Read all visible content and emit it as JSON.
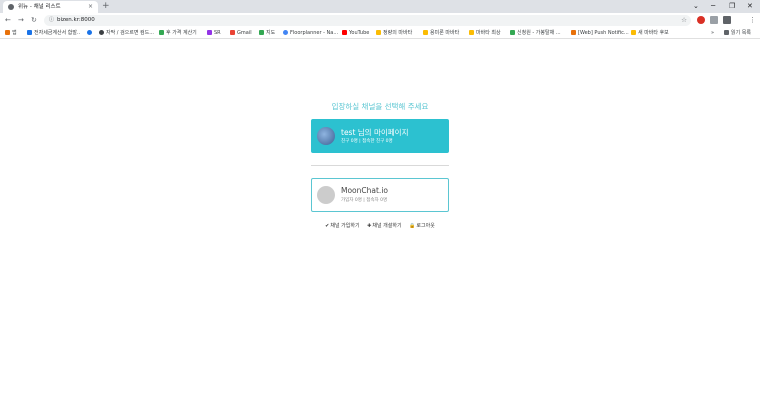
{
  "browser": {
    "tab_title": "위뉴 - 채널 리스트",
    "tab_close": "×",
    "new_tab": "+",
    "url": "bizen.kr:8000",
    "window_controls": [
      "⌄",
      "─",
      "❐",
      "✕"
    ]
  },
  "bookmarks": [
    {
      "label": "앱",
      "color": "#e8710a"
    },
    {
      "label": "전자세금계산서 합발..",
      "color": "#1a73e8"
    },
    {
      "label": "",
      "color": "#1a73e8"
    },
    {
      "label": "자막 / 검으르면 컴드...",
      "color": "#3c4043"
    },
    {
      "label": "후 가격 계산기",
      "color": "#34a853"
    },
    {
      "label": "SR",
      "color": "#9334e6"
    },
    {
      "label": "Gmail",
      "color": "#ea4335"
    },
    {
      "label": "지도",
      "color": "#34a853"
    },
    {
      "label": "Floorplanner - Na...",
      "color": "#4285f4"
    },
    {
      "label": "YouTube",
      "color": "#ff0000"
    },
    {
      "label": "정량의 마바타",
      "color": "#fbbc04"
    },
    {
      "label": "용미론 마바타",
      "color": "#fbbc04"
    },
    {
      "label": "마바타 최상",
      "color": "#fbbc04"
    },
    {
      "label": "신청원 - 가봉탈채 ...",
      "color": "#34a853"
    },
    {
      "label": "[Web] Push Notific...",
      "color": "#e8710a"
    },
    {
      "label": "새 마바타 후보",
      "color": "#fbbc04"
    },
    {
      "label": "»",
      "color": ""
    },
    {
      "label": "읽기 목록",
      "color": "#5f6368"
    }
  ],
  "main": {
    "prompt": "입장하실 채널을 선택해 주세요",
    "channels": [
      {
        "name": "test 님의 마이페이지",
        "meta": "친구 0명 | 접속한 친구 0명"
      },
      {
        "name": "MoonChat.io",
        "meta": "가입자 0명 | 접속자 0명"
      }
    ],
    "links": [
      {
        "icon": "✔",
        "label": "채널 가입하기"
      },
      {
        "icon": "✚",
        "label": "채널 개설하기"
      },
      {
        "icon": "🔒",
        "label": "로그아웃"
      }
    ]
  }
}
